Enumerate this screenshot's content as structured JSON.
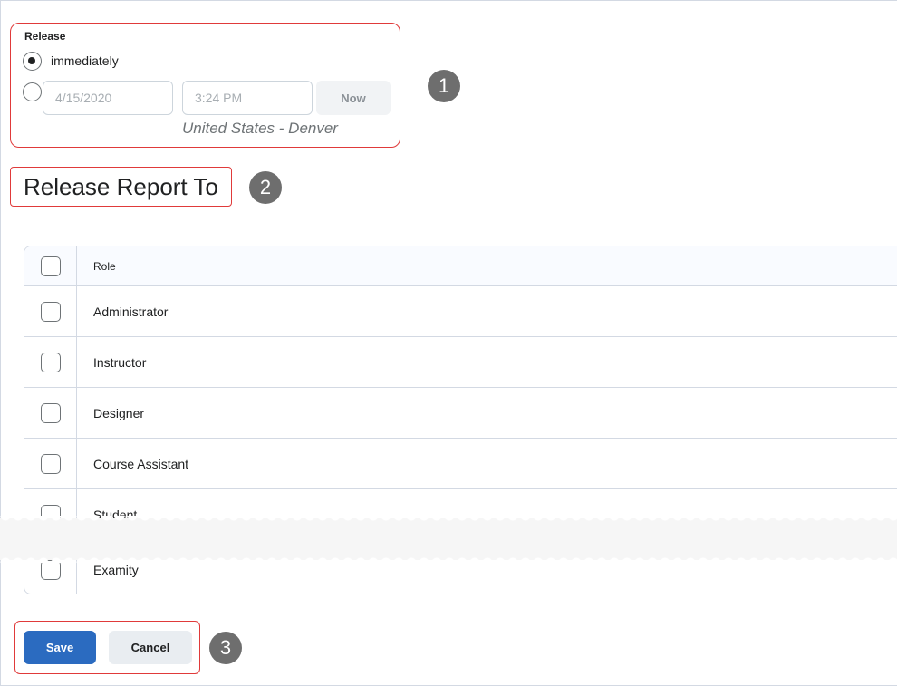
{
  "release": {
    "label": "Release",
    "option_immediately": "immediately",
    "date_placeholder": "4/15/2020",
    "time_placeholder": "3:24 PM",
    "now_label": "Now",
    "timezone": "United States - Denver"
  },
  "heading": "Release Report To",
  "table": {
    "header": "Role",
    "rows": [
      "Administrator",
      "Instructor",
      "Designer",
      "Course Assistant",
      "Student",
      "Examity"
    ]
  },
  "actions": {
    "save_label": "Save",
    "cancel_label": "Cancel"
  },
  "callouts": [
    "1",
    "2",
    "3"
  ],
  "colors": {
    "callout_border": "#e03a3a",
    "badge": "#6e6e6e",
    "primary": "#2b6bc0"
  }
}
